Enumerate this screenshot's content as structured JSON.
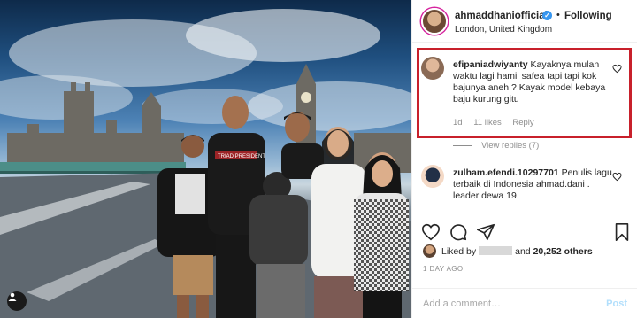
{
  "post": {
    "username": "ahmaddhaniofficial",
    "follow_label": "Following",
    "dot": "•",
    "location": "London, United Kingdom",
    "verified_icon": "verified-badge-icon"
  },
  "photo": {
    "shirt_text": "TRIAD PRESIDENT"
  },
  "comments": [
    {
      "username": "efipaniadwiyanty",
      "text": "Kayaknya mulan waktu lagi hamil safea tapi tapi kok bajunya aneh ? Kayak model kebaya baju kurung gitu",
      "time": "1d",
      "likes": "11 likes",
      "reply": "Reply",
      "highlight_color": "#c8202b"
    },
    {
      "username": "zulham.efendi.10297701",
      "text": "Penulis lagu terbaik di Indonesia ahmad.dani . leader dewa 19"
    }
  ],
  "view_replies": "View replies (7)",
  "likes": {
    "prefix": "Liked by",
    "suffix_and": "and",
    "count": "20,252 others"
  },
  "time_ago": "1 DAY AGO",
  "add_comment": {
    "placeholder": "Add a comment…",
    "post_label": "Post"
  },
  "icons": [
    "heart-icon",
    "comment-icon",
    "share-icon",
    "bookmark-icon",
    "tag-user-icon"
  ],
  "colors": {
    "link": "#b2dffc",
    "verified": "#3897f0",
    "muted": "#8e8e8e"
  }
}
